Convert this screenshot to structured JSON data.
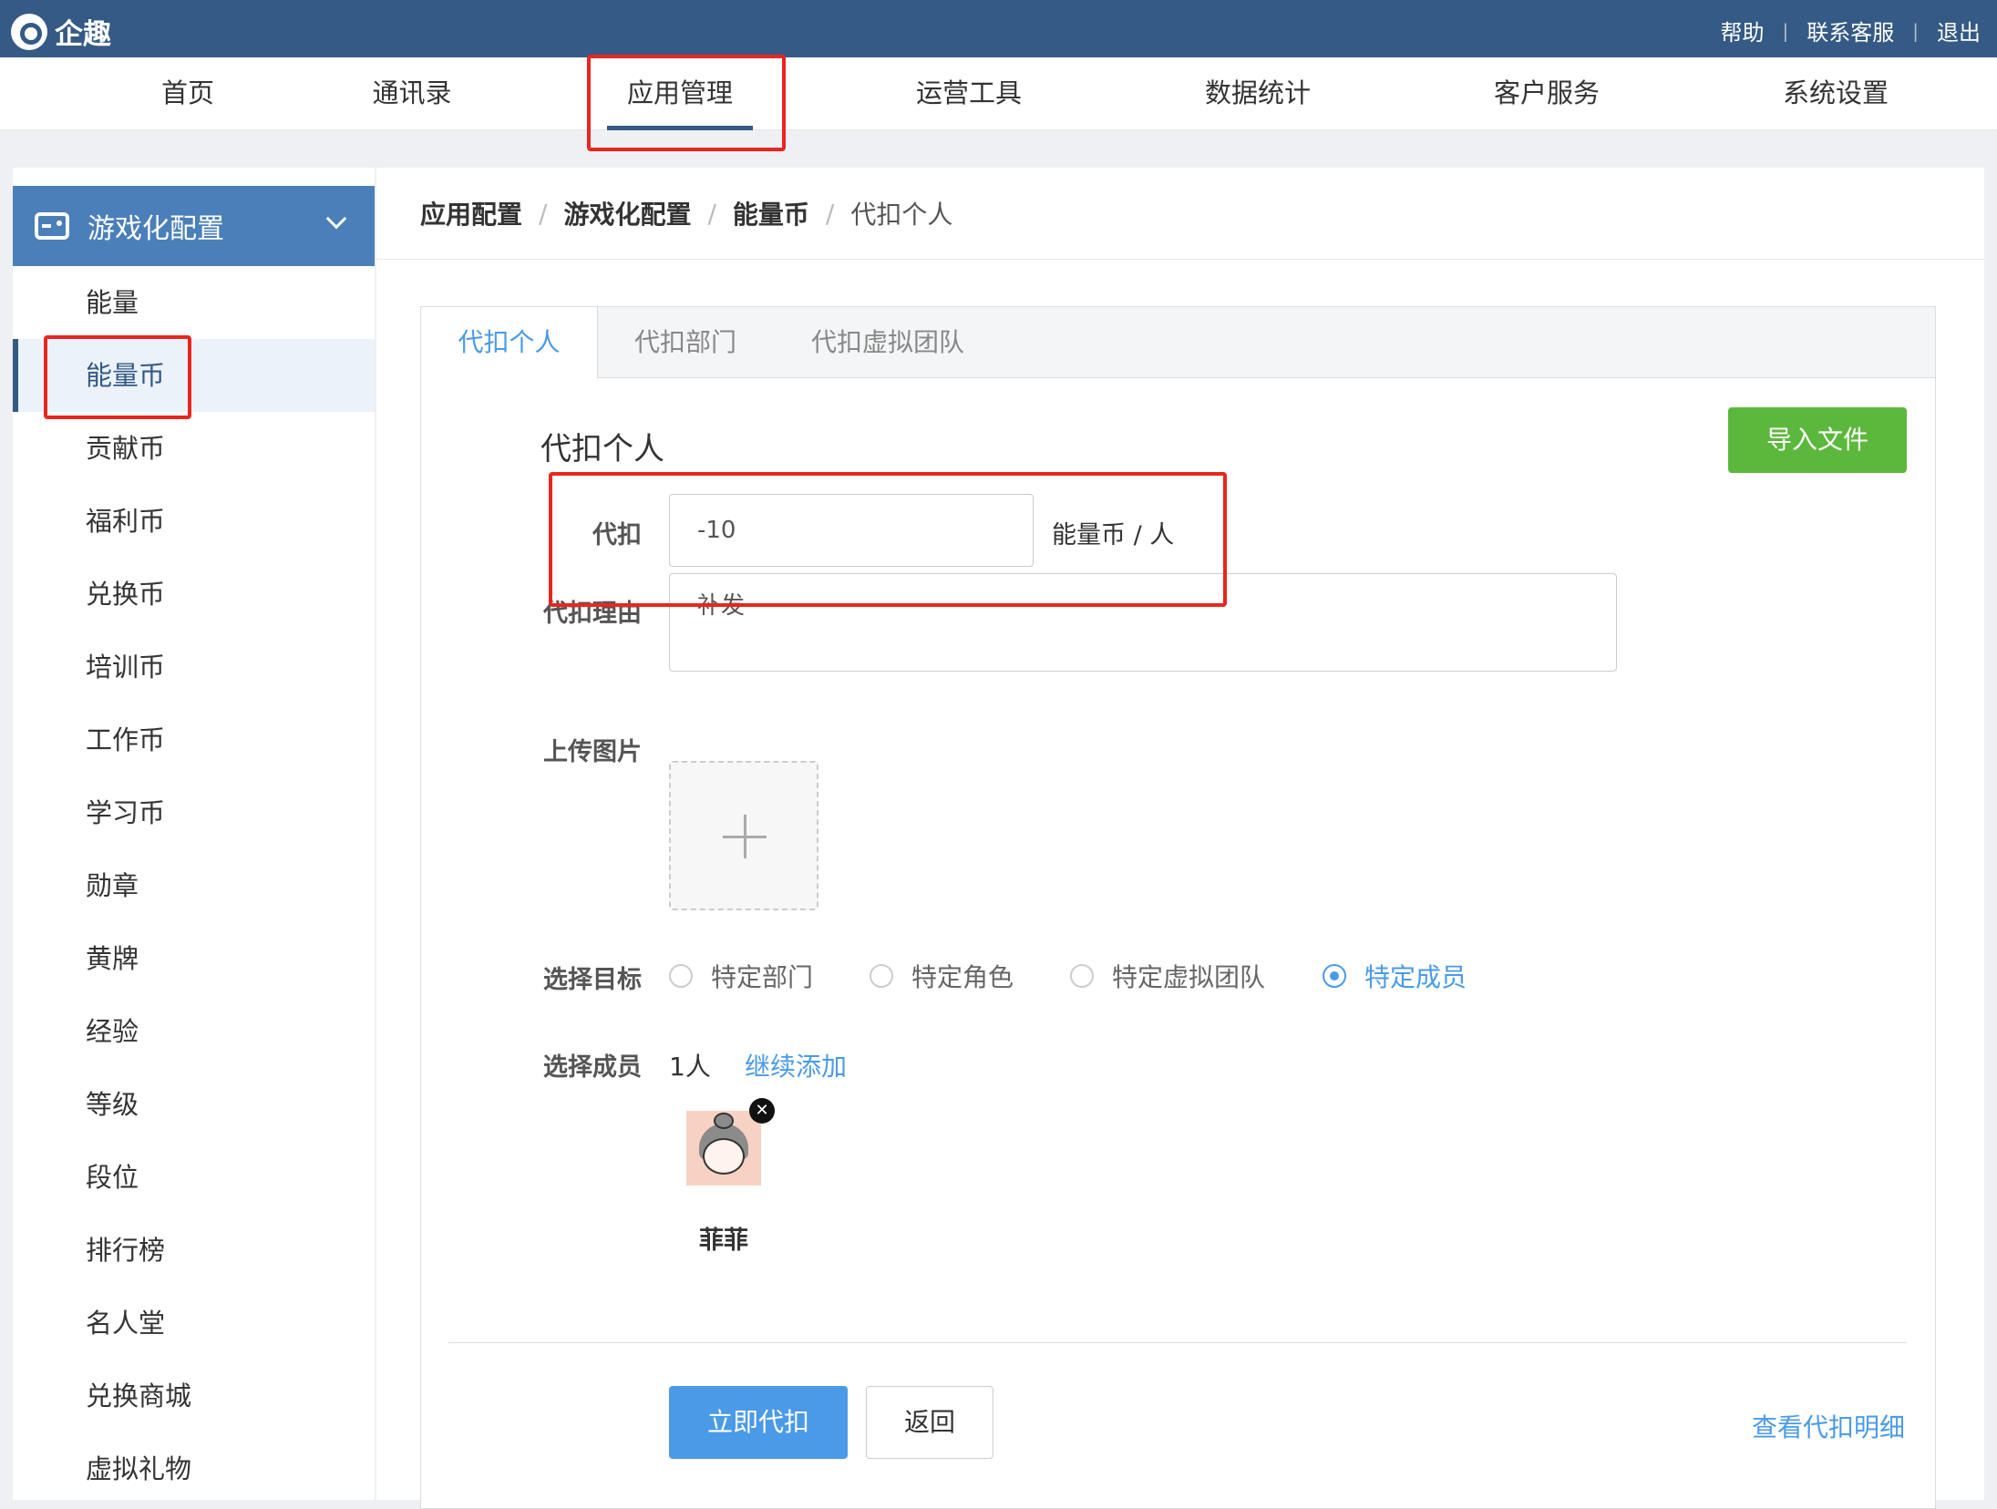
{
  "topbar": {
    "brand": "企趣",
    "links": [
      "帮助",
      "联系客服",
      "退出"
    ],
    "separator": "|"
  },
  "nav": {
    "items": [
      "首页",
      "通讯录",
      "应用管理",
      "运营工具",
      "数据统计",
      "客户服务",
      "系统设置"
    ],
    "active_index": 2
  },
  "sidebar": {
    "group_title": "游戏化配置",
    "items": [
      "能量",
      "能量币",
      "贡献币",
      "福利币",
      "兑换币",
      "培训币",
      "工作币",
      "学习币",
      "勋章",
      "黄牌",
      "经验",
      "等级",
      "段位",
      "排行榜",
      "名人堂",
      "兑换商城",
      "虚拟礼物"
    ],
    "active_index": 1
  },
  "breadcrumb": {
    "items": [
      "应用配置",
      "游戏化配置",
      "能量币",
      "代扣个人"
    ],
    "separator": "/"
  },
  "tabs": {
    "items": [
      "代扣个人",
      "代扣部门",
      "代扣虚拟团队"
    ],
    "active_index": 0
  },
  "form": {
    "section_title": "代扣个人",
    "import_button": "导入文件",
    "deduct_label": "代扣",
    "deduct_value": "-10",
    "deduct_unit": "能量币 / 人",
    "reason_label": "代扣理由",
    "reason_value": "补发",
    "upload_label": "上传图片",
    "target_label": "选择目标",
    "target_options": [
      "特定部门",
      "特定角色",
      "特定虚拟团队",
      "特定成员"
    ],
    "target_selected_index": 3,
    "member_label": "选择成员",
    "member_count": "1人",
    "add_more": "继续添加",
    "members": [
      {
        "name": "菲菲"
      }
    ],
    "submit_button": "立即代扣",
    "back_button": "返回",
    "detail_link": "查看代扣明细"
  },
  "colors": {
    "topbar": "#345a85",
    "primary": "#4a9ae8",
    "success": "#5cb83c",
    "highlight_box": "#e8261f"
  }
}
